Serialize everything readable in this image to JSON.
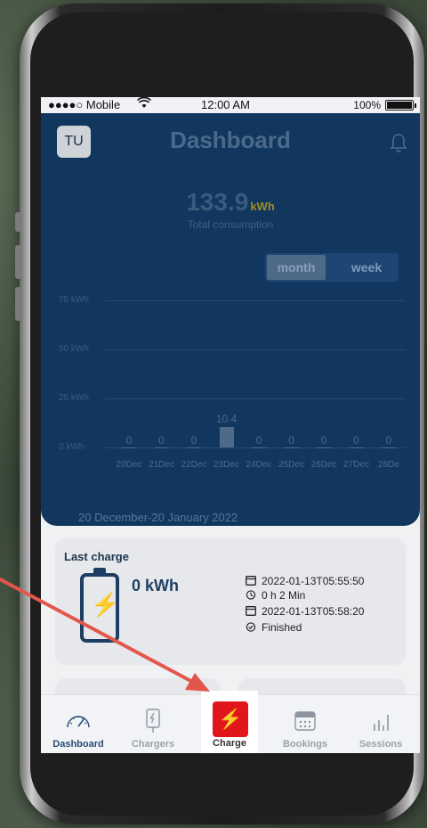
{
  "status": {
    "carrier": "●●●●○ Mobile",
    "time": "12:00 AM",
    "battery": "100%"
  },
  "header": {
    "avatar": "TU",
    "title": "Dashboard"
  },
  "summary": {
    "value": "133.9",
    "unit": "kWh",
    "label": "Total consumption"
  },
  "toggle": {
    "month": "month",
    "week": "week",
    "selected": "month"
  },
  "chart_data": {
    "type": "bar",
    "categories": [
      "20Dec",
      "21Dec",
      "22Dec",
      "23Dec",
      "24Dec",
      "25Dec",
      "26Dec",
      "27Dec",
      "28De"
    ],
    "values": [
      0,
      0,
      0,
      10.4,
      0,
      0,
      0,
      0,
      0
    ],
    "value_labels": [
      "0",
      "0",
      "0",
      "10.4",
      "0",
      "0",
      "0",
      "0",
      "0"
    ],
    "y_ticks": [
      "0 kWh",
      "25 kWh",
      "50 kWh",
      "75 kWh"
    ],
    "ylim": [
      0,
      75
    ]
  },
  "date_range": "20 December-20 January 2022",
  "last_charge": {
    "title": "Last charge",
    "energy": "0 kWh",
    "start": "2022-01-13T05:55:50",
    "duration": "0 h 2 Min",
    "end": "2022-01-13T05:58:20",
    "status": "Finished"
  },
  "tabs": {
    "dashboard": "Dashboard",
    "chargers": "Chargers",
    "charge": "Charge",
    "bookings": "Bookings",
    "sessions": "Sessions"
  },
  "colors": {
    "primary": "#11375f",
    "accent": "#e0161b",
    "arrow": "#e2574c"
  }
}
